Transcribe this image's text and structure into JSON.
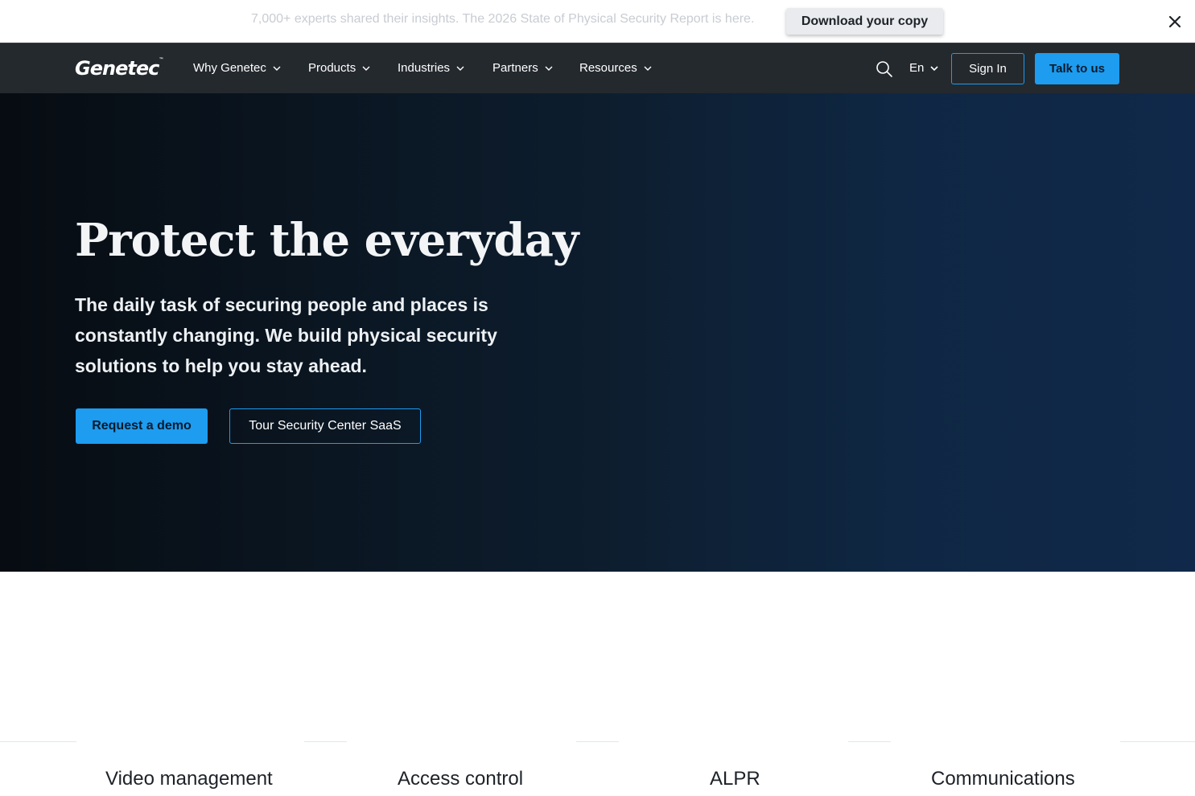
{
  "announcement": {
    "text": "7,000+ experts shared their insights. The 2026 State of Physical Security Report is here.",
    "button": "Download your copy",
    "close_icon": "close-icon"
  },
  "nav": {
    "logo": "Genetec",
    "logo_mark": "™",
    "items": [
      {
        "label": "Why Genetec"
      },
      {
        "label": "Products"
      },
      {
        "label": "Industries"
      },
      {
        "label": "Partners"
      },
      {
        "label": "Resources"
      }
    ],
    "search_icon": "search-icon",
    "language": "En",
    "sign_in": "Sign In",
    "talk": "Talk to us"
  },
  "hero": {
    "title": "Protect the everyday",
    "subtitle": "The daily task of securing people and places is constantly changing. We build physical security solutions to help you stay ahead.",
    "primary_button": "Request a demo",
    "secondary_button": "Tour Security Center SaaS"
  },
  "products": [
    {
      "label": "Video management"
    },
    {
      "label": "Access control"
    },
    {
      "label": "ALPR"
    },
    {
      "label": "Communications"
    }
  ],
  "colors": {
    "accent": "#1d9cf0",
    "nav_bg": "#24292e",
    "hero_dark": "#070c12",
    "hero_light": "#10294a"
  }
}
